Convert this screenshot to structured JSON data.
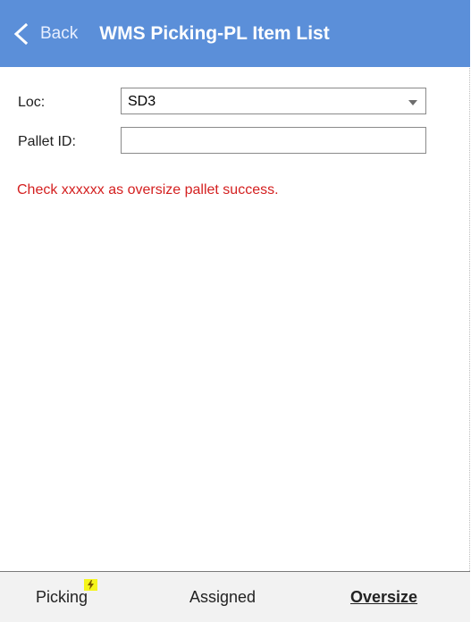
{
  "header": {
    "back_label": "Back",
    "title": "WMS Picking-PL Item List",
    "background": "#5b8fd9"
  },
  "form": {
    "loc": {
      "label": "Loc:",
      "value": "SD3"
    },
    "pallet": {
      "label": "Pallet ID:",
      "value": ""
    }
  },
  "message": {
    "text": "Check xxxxxx as oversize pallet success.",
    "color": "#d42020"
  },
  "footer": {
    "tabs": [
      {
        "label": "Picking",
        "badge_icon": "lightning-icon"
      },
      {
        "label": "Assigned"
      },
      {
        "label": "Oversize",
        "active": true
      }
    ]
  }
}
